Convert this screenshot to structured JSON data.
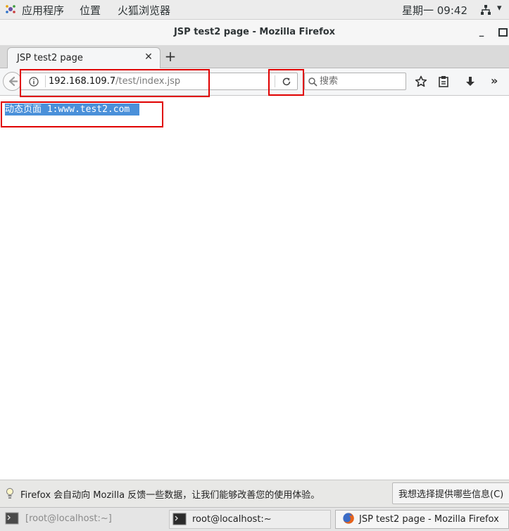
{
  "topbar": {
    "apps_menu": "应用程序",
    "places_menu": "位置",
    "app_name": "火狐浏览器",
    "clock": "星期一 09:42"
  },
  "window": {
    "title": "JSP test2 page - Mozilla Firefox"
  },
  "tabs": [
    {
      "title": "JSP test2 page"
    }
  ],
  "navbar": {
    "url_host": "192.168.109.7",
    "url_path": "/test/index.jsp",
    "search_placeholder": "搜索"
  },
  "content": {
    "text": "动态页面 1:www.test2.com"
  },
  "notification": {
    "text": "Firefox 会自动向 Mozilla 反馈一些数据，让我们能够改善您的使用体验。",
    "button_label": "我想选择提供哪些信息(C)"
  },
  "taskbar": {
    "items": [
      {
        "label": "[root@localhost:~]"
      },
      {
        "label": "root@localhost:~"
      },
      {
        "label": "JSP test2 page - Mozilla Firefox"
      }
    ]
  },
  "colors": {
    "annotation": "#e00000",
    "selection": "#4a90d9"
  }
}
